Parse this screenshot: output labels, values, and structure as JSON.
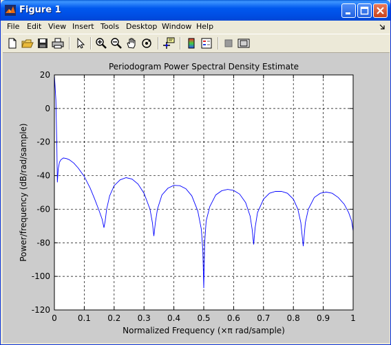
{
  "window": {
    "title": "Figure 1",
    "controls": [
      "minimize",
      "maximize",
      "close"
    ]
  },
  "menu": {
    "items": [
      "File",
      "Edit",
      "View",
      "Insert",
      "Tools",
      "Desktop",
      "Window",
      "Help"
    ]
  },
  "toolbar": {
    "tools": [
      "new-figure",
      "open-file",
      "save-figure",
      "print-figure",
      "edit-plot",
      "zoom-in",
      "zoom-out",
      "pan",
      "rotate-3d",
      "data-cursor",
      "insert-colorbar",
      "insert-legend",
      "hide-plot-tools",
      "show-plot-tools"
    ]
  },
  "colors": {
    "line": "#0000ff",
    "axes_bg": "#ffffff",
    "figure_bg": "#cccccc",
    "titlebar": "#0058ee"
  },
  "chart_data": {
    "type": "line",
    "title": "Periodogram Power Spectral Density Estimate",
    "xlabel": "Normalized Frequency  (×π rad/sample)",
    "ylabel": "Power/frequency (dB/rad/sample)",
    "xlim": [
      0,
      1
    ],
    "ylim": [
      -120,
      20
    ],
    "xticks": [
      "0",
      "0.1",
      "0.2",
      "0.3",
      "0.4",
      "0.5",
      "0.6",
      "0.7",
      "0.8",
      "0.9",
      "1"
    ],
    "yticks": [
      "20",
      "0",
      "-20",
      "-40",
      "-60",
      "-80",
      "-100",
      "-120"
    ],
    "grid": true,
    "grid_style": "dashed",
    "series": [
      {
        "color": "#0000ff",
        "x": [
          0,
          0.002,
          0.005,
          0.008,
          0.01,
          0.013,
          0.017,
          0.022,
          0.03,
          0.04,
          0.05,
          0.065,
          0.08,
          0.1,
          0.12,
          0.135,
          0.15,
          0.16,
          0.166,
          0.17,
          0.175,
          0.185,
          0.2,
          0.22,
          0.24,
          0.26,
          0.28,
          0.3,
          0.32,
          0.328,
          0.333,
          0.338,
          0.345,
          0.36,
          0.38,
          0.4,
          0.42,
          0.44,
          0.46,
          0.48,
          0.492,
          0.497,
          0.5,
          0.503,
          0.508,
          0.52,
          0.54,
          0.56,
          0.58,
          0.6,
          0.62,
          0.64,
          0.655,
          0.662,
          0.667,
          0.672,
          0.68,
          0.7,
          0.72,
          0.74,
          0.76,
          0.78,
          0.8,
          0.815,
          0.825,
          0.833,
          0.84,
          0.85,
          0.87,
          0.89,
          0.91,
          0.93,
          0.95,
          0.97,
          0.985,
          0.995,
          1.0
        ],
        "y": [
          20,
          14,
          5,
          -20,
          -44,
          -36,
          -32,
          -30.5,
          -29.5,
          -29.8,
          -30.5,
          -32.5,
          -35.5,
          -40.5,
          -47.5,
          -54,
          -61,
          -66,
          -71,
          -67,
          -60,
          -52,
          -46,
          -42.5,
          -41.2,
          -42,
          -45,
          -50.5,
          -60,
          -68,
          -76,
          -68,
          -60,
          -51.5,
          -47.5,
          -45.8,
          -46,
          -47.8,
          -52,
          -61,
          -72,
          -85,
          -107,
          -80,
          -67,
          -58.5,
          -51.5,
          -49,
          -48.2,
          -48.8,
          -51,
          -56,
          -64,
          -72,
          -81,
          -71,
          -62,
          -54,
          -50.5,
          -49.4,
          -49.4,
          -50.5,
          -54,
          -60,
          -68,
          -82,
          -68,
          -60,
          -53,
          -50.5,
          -49.8,
          -50.5,
          -53,
          -57,
          -62,
          -67,
          -73
        ]
      }
    ]
  }
}
